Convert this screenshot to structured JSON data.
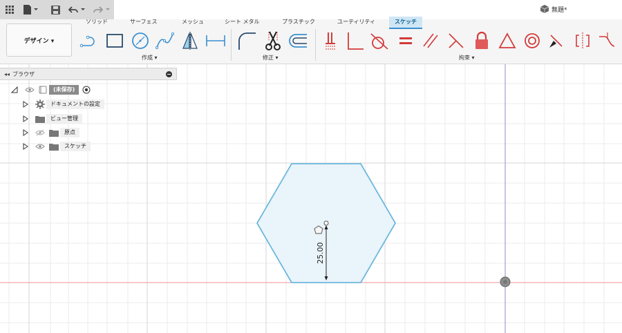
{
  "qat": {
    "icons": [
      "apps-grid-icon",
      "file-icon",
      "save-icon",
      "undo-icon",
      "redo-icon"
    ]
  },
  "document": {
    "title": "無題*"
  },
  "ribbon": {
    "tabs": [
      {
        "label": "ソリッド"
      },
      {
        "label": "サーフェス"
      },
      {
        "label": "メッシュ"
      },
      {
        "label": "シート メタル"
      },
      {
        "label": "プラスチック"
      },
      {
        "label": "ユーティリティ"
      },
      {
        "label": "スケッチ",
        "active": true
      }
    ],
    "workspace_label": "デザイン ▾",
    "groups": {
      "create": "作成 ▾",
      "modify": "修正 ▾",
      "constraints": "拘束 ▾"
    }
  },
  "browser": {
    "title": "ブラウザ",
    "root": "(未保存)",
    "items": [
      {
        "label": "ドキュメントの設定",
        "icon": "gear-icon"
      },
      {
        "label": "ビュー管理",
        "icon": "folder-icon"
      },
      {
        "label": "原点",
        "icon": "folder-icon"
      },
      {
        "label": "スケッチ",
        "icon": "folder-icon"
      }
    ]
  },
  "sketch": {
    "dimension": "25.00"
  },
  "colors": {
    "accent": "#3a8fd0",
    "hex_fill": "#eaf4fb",
    "hex_stroke": "#6cb8dd",
    "axis_red": "#f4a6b0",
    "axis_blue": "#a9a3d8",
    "constraint_red": "#d43a3a"
  }
}
